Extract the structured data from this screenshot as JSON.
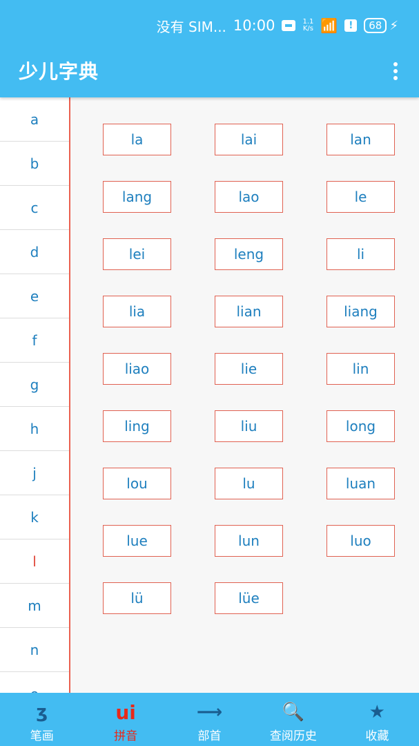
{
  "status": {
    "carrier": "没有 SIM...",
    "time": "10:00",
    "speed_top": "1.1",
    "speed_bottom": "K/s",
    "battery": "68"
  },
  "appbar": {
    "title": "少儿字典"
  },
  "sidebar": {
    "letters": [
      "a",
      "b",
      "c",
      "d",
      "e",
      "f",
      "g",
      "h",
      "j",
      "k",
      "l",
      "m",
      "n",
      "o"
    ],
    "active": "l"
  },
  "syllables": [
    "la",
    "lai",
    "lan",
    "lang",
    "lao",
    "le",
    "lei",
    "leng",
    "li",
    "lia",
    "lian",
    "liang",
    "liao",
    "lie",
    "lin",
    "ling",
    "liu",
    "long",
    "lou",
    "lu",
    "luan",
    "lue",
    "lun",
    "luo",
    "lü",
    "lüe"
  ],
  "tabs": [
    {
      "label": "笔画",
      "icon": "ʒ",
      "icon_name": "stroke-icon",
      "active": false
    },
    {
      "label": "拼音",
      "icon": "ui",
      "icon_name": "pinyin-icon",
      "active": true
    },
    {
      "label": "部首",
      "icon": "⟶",
      "icon_name": "radical-icon",
      "active": false
    },
    {
      "label": "查阅历史",
      "icon": "🔍",
      "icon_name": "history-search-icon",
      "active": false
    },
    {
      "label": "收藏",
      "icon": "★",
      "icon_name": "favorite-folder-icon",
      "active": false
    }
  ],
  "colors": {
    "primary": "#43bcf2",
    "accent": "#e8281a",
    "text_blue": "#1e7fbe",
    "border_red": "#e06050"
  }
}
